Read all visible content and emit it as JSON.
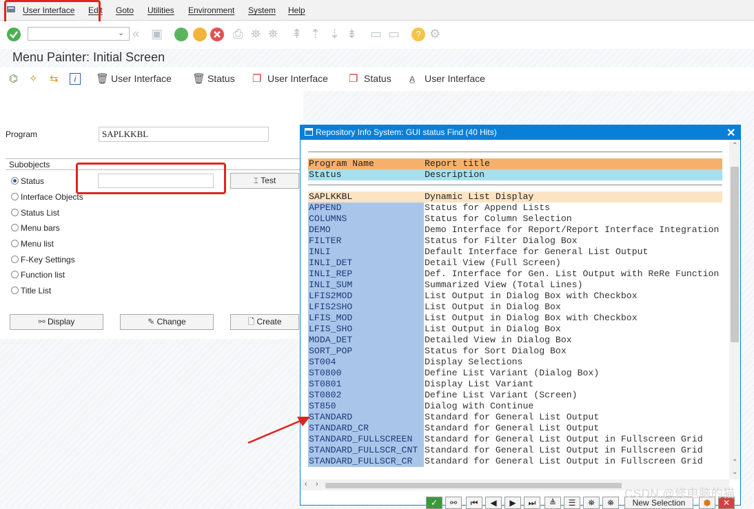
{
  "menu": {
    "items": [
      "User Interface",
      "Edit",
      "Goto",
      "Utilities",
      "Environment",
      "System",
      "Help"
    ]
  },
  "toolbar": {
    "icons": [
      "enter-icon",
      "back-icon",
      "save-icon",
      "back-green-icon",
      "exit-icon",
      "cancel-icon",
      "print-icon",
      "find-icon",
      "find-next-icon",
      "first-page-icon",
      "prev-page-icon",
      "next-page-icon",
      "last-page-icon",
      "new-session-icon",
      "shortcut-icon",
      "help-icon",
      "settings-icon"
    ],
    "command_field_value": ""
  },
  "screen": {
    "title": "Menu Painter: Initial Screen"
  },
  "app_toolbar": {
    "delete_ui_label": "User Interface",
    "delete_status_label": "Status",
    "copy_ui_label": "User Interface",
    "copy_status_label": "Status",
    "rename_ui_label": "User Interface"
  },
  "form": {
    "program_label": "Program",
    "program_value": "SAPLKKBL",
    "subobjects_title": "Subobjects",
    "status_value": "",
    "test_label": "Test",
    "radios": [
      "Status",
      "Interface Objects",
      "Status List",
      "Menu bars",
      "Menu list",
      "F-Key Settings",
      "Function list",
      "Title List"
    ],
    "selected_radio": "Status",
    "display_label": "Display",
    "change_label": "Change",
    "create_label": "Create"
  },
  "popup": {
    "title": "Repository Info System: GUI status Find (40 Hits)",
    "header1": {
      "col1": "Program Name",
      "col2": "Report title"
    },
    "header2": {
      "col1": "Status",
      "col2": "Description"
    },
    "program_row": {
      "col1": "SAPLKKBL",
      "col2": "Dynamic List Display"
    },
    "rows": [
      {
        "status": "APPEND",
        "description": "Status for Append Lists"
      },
      {
        "status": "COLUMNS",
        "description": "Status for Column Selection"
      },
      {
        "status": "DEMO",
        "description": "Demo Interface for Report/Report Interface Integration"
      },
      {
        "status": "FILTER",
        "description": "Status for Filter Dialog Box"
      },
      {
        "status": "INLI",
        "description": "Default Interface for General List Output"
      },
      {
        "status": "INLI_DET",
        "description": "Detail View (Full Screen)"
      },
      {
        "status": "INLI_REP",
        "description": "Def. Interface for Gen. List Output with ReRe Function"
      },
      {
        "status": "INLI_SUM",
        "description": "Summarized View (Total Lines)"
      },
      {
        "status": "LFIS2MOD",
        "description": "List Output in Dialog Box with Checkbox"
      },
      {
        "status": "LFIS2SHO",
        "description": "List Output in Dialog Box"
      },
      {
        "status": "LFIS_MOD",
        "description": "List Output in Dialog Box with Checkbox"
      },
      {
        "status": "LFIS_SHO",
        "description": "List Output in Dialog Box"
      },
      {
        "status": "MODA_DET",
        "description": "Detailed View in Dialog Box"
      },
      {
        "status": "SORT_POP",
        "description": "Status for Sort Dialog Box"
      },
      {
        "status": "ST004",
        "description": "Display Selections"
      },
      {
        "status": "ST0800",
        "description": "Define List Variant (Dialog Box)"
      },
      {
        "status": "ST0801",
        "description": "Display List Variant"
      },
      {
        "status": "ST0802",
        "description": "Define List Variant (Screen)"
      },
      {
        "status": "ST850",
        "description": "Dialog with Continue"
      },
      {
        "status": "STANDARD",
        "description": "Standard for General List Output"
      },
      {
        "status": "STANDARD_CR",
        "description": "Standard for General List Output"
      },
      {
        "status": "STANDARD_FULLSCREEN",
        "description": "Standard for General List Output in Fullscreen Grid"
      },
      {
        "status": "STANDARD_FULLSCR_CNT",
        "description": "Standard for General List Output in Fullscreen Grid"
      },
      {
        "status": "STANDARD_FULLSCR_CR",
        "description": "Standard for General List Output in Fullscreen Grid"
      }
    ],
    "new_selection_label": "New Selection"
  },
  "watermark": "CSDN @修电脑的猫",
  "colors": {
    "title_bar": "#0b7fd8",
    "header_orange": "#f7b06b",
    "header_cyan": "#a6e0ee",
    "program_row": "#fbe3c4",
    "status_cell": "#a9c6ea",
    "annotation_red": "#e1231e"
  }
}
